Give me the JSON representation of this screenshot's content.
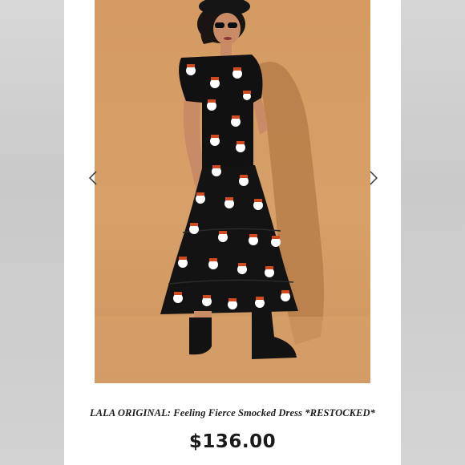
{
  "listing": {
    "title": "LALA ORIGINAL: Feeling Fierce Smocked Dress *RESTOCKED*",
    "price": "$136.00"
  },
  "carousel": {
    "prev_icon": "chevron-left-icon",
    "next_icon": "chevron-right-icon"
  },
  "colors": {
    "backdrop": "#d49a61",
    "dress": "#111111",
    "print_accent": "#d24a1c",
    "card": "#ffffff"
  }
}
